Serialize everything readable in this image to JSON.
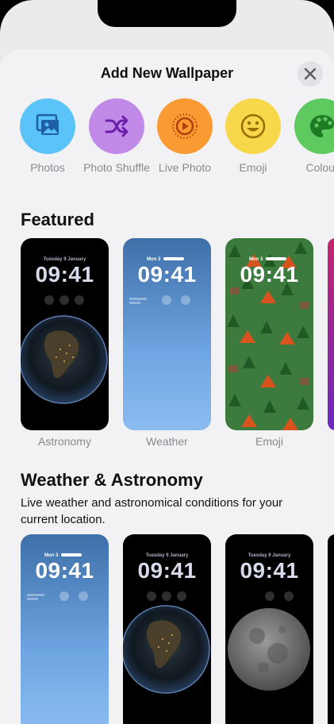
{
  "sheet": {
    "title": "Add New Wallpaper",
    "close_icon": "close-icon"
  },
  "categories": [
    {
      "label": "Photos",
      "icon": "photos-icon",
      "color": "#5ac4f8"
    },
    {
      "label": "Photo Shuffle",
      "icon": "shuffle-icon",
      "color": "#c28ae8"
    },
    {
      "label": "Live Photo",
      "icon": "live-photo-icon",
      "color": "#f99a33"
    },
    {
      "label": "Emoji",
      "icon": "emoji-icon",
      "color": "#f7d84a"
    },
    {
      "label": "Colour",
      "icon": "palette-icon",
      "color": "#5ec95e"
    }
  ],
  "featured": {
    "title": "Featured",
    "cards": [
      {
        "label": "Astronomy",
        "date": "Tuesday 9 January",
        "time": "09:41"
      },
      {
        "label": "Weather",
        "date": "Mon 3",
        "time": "09:41"
      },
      {
        "label": "Emoji",
        "date": "Mon 3",
        "time": "09:41"
      }
    ]
  },
  "weather_astronomy": {
    "title": "Weather & Astronomy",
    "description": "Live weather and astronomical conditions for your current location.",
    "cards": [
      {
        "date": "Mon 3",
        "time": "09:41"
      },
      {
        "date": "Tuesday 9 January",
        "time": "09:41"
      },
      {
        "date": "Tuesday 9 January",
        "time": "09:41"
      }
    ]
  }
}
